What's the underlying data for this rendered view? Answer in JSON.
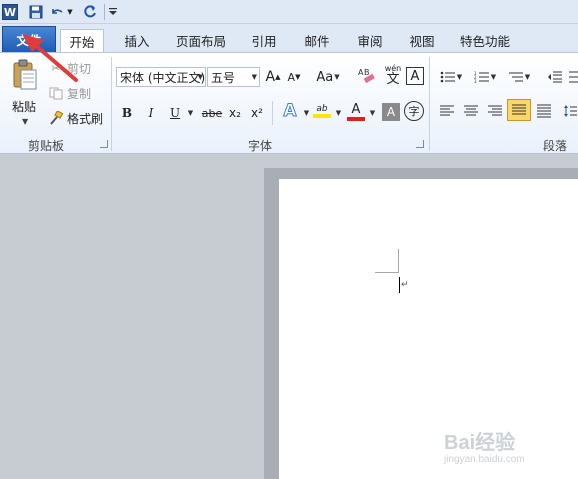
{
  "qat": {
    "app_icon": "word-icon",
    "app_icon_letter": "W",
    "save": "save-icon",
    "undo": "undo-icon",
    "redo": "repeat-icon",
    "customize": "customize-dropdown-icon"
  },
  "tabs": [
    {
      "label": "文件",
      "active": false
    },
    {
      "label": "开始",
      "active": true
    },
    {
      "label": "插入"
    },
    {
      "label": "页面布局"
    },
    {
      "label": "引用"
    },
    {
      "label": "邮件"
    },
    {
      "label": "审阅"
    },
    {
      "label": "视图"
    },
    {
      "label": "特色功能"
    }
  ],
  "clipboard": {
    "paste_label": "粘贴",
    "cut_label": "剪切",
    "copy_label": "复制",
    "format_painter_label": "格式刷",
    "group_label": "剪贴板"
  },
  "font": {
    "font_name": "宋体 (中文正文)",
    "font_size": "五号",
    "grow": "A",
    "shrink": "A",
    "case": "Aa",
    "bold": "B",
    "italic": "I",
    "underline": "U",
    "strikethrough": "abe",
    "subscript": "x₂",
    "superscript": "x²",
    "text_effect": "A",
    "highlight": "ab",
    "font_color": "A",
    "char_shading": "A",
    "enclose": "字",
    "pinyin": "wén",
    "pinyin_char": "文",
    "border_char": "A",
    "clear_format": "A",
    "group_label": "字体"
  },
  "paragraph": {
    "group_label": "段落"
  },
  "colors": {
    "file_tab": "#1f5cb5",
    "accent_red": "#e03c3c",
    "highlight_yellow": "#ffe500",
    "active_align": "#fcd66a"
  },
  "watermark": {
    "text": "Bai经验",
    "sub": "jingyan.baidu.com"
  }
}
